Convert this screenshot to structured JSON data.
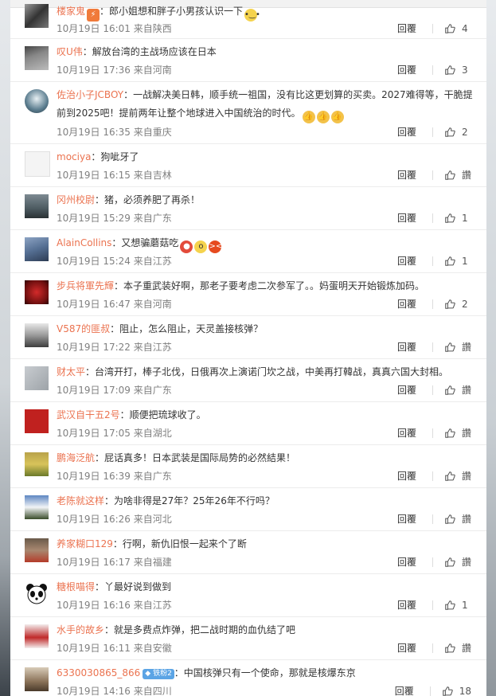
{
  "comments": [
    {
      "user": "楼家鬼",
      "text": "：郎小姐想和胖子小男孩认识一下",
      "time": "10月19日 16:01 来自陕西",
      "reply": "回覆",
      "likes": "4"
    },
    {
      "user": "叹U伟",
      "text": "：解放台湾的主战场应该在日本",
      "time": "10月19日 17:36 来自河南",
      "reply": "回覆",
      "likes": "3"
    },
    {
      "user": "佐治小子JCBOY",
      "text": "：一战解决美日韩，顺手统一祖国，没有比这更划算的买卖。2027难得等，干脆提前到2025吧！提前两年让整个地球进入中国统治的时代。",
      "time": "10月19日 16:35 来自重庆",
      "reply": "回覆",
      "likes": "2"
    },
    {
      "user": "mociya",
      "text": "：狗呲牙了",
      "time": "10月19日 16:15 来自吉林",
      "reply": "回覆",
      "likes": "讚"
    },
    {
      "user": "冈州校尉",
      "text": "：猪，必须养肥了再杀！",
      "time": "10月19日 15:29 来自广东",
      "reply": "回覆",
      "likes": "1"
    },
    {
      "user": "AlainCollins",
      "text": "：又想骗蘑菇吃",
      "time": "10月19日 15:24 来自江苏",
      "reply": "回覆",
      "likes": "1"
    },
    {
      "user": "步兵将軍先輝",
      "text": "：本子重武装好啊，那老子要考虑二次参军了。。妈蛋明天开始锻炼加码。",
      "time": "10月19日 16:47 来自河南",
      "reply": "回覆",
      "likes": "2"
    },
    {
      "user": "V587的匪叔",
      "text": "：阻止，怎么阻止，天灵盖接核弹？",
      "time": "10月19日 17:22 来自江苏",
      "reply": "回覆",
      "likes": "讚"
    },
    {
      "user": "财太平",
      "text": "：台湾开打，棒子北伐，日俄再次上演诺门坎之战，中美再打韓战，真真六国大封相。",
      "time": "10月19日 17:09 来自广东",
      "reply": "回覆",
      "likes": "讚"
    },
    {
      "user": "武汉自干五2号",
      "text": "：顺便把琉球收了。",
      "time": "10月19日 17:05 来自湖北",
      "reply": "回覆",
      "likes": "讚"
    },
    {
      "user": "鹏海泛航",
      "text": "：屁话真多！日本武装是国际局势的必然結果！",
      "time": "10月19日 16:39 来自广东",
      "reply": "回覆",
      "likes": "讚"
    },
    {
      "user": "老陈就这样",
      "text": "：为啥非得是27年？25年26年不行吗？",
      "time": "10月19日 16:26 来自河北",
      "reply": "回覆",
      "likes": "讚"
    },
    {
      "user": "养家糊口129",
      "text": "：行啊，新仇旧恨一起来个了断",
      "time": "10月19日 16:17 来自福建",
      "reply": "回覆",
      "likes": "讚"
    },
    {
      "user": "糖根喵得",
      "text": "：丫最好说到做到",
      "time": "10月19日 16:16 来自江苏",
      "reply": "回覆",
      "likes": "1"
    },
    {
      "user": "水手的故乡",
      "text": "：就是多费点炸弹，把二战时期的血仇结了吧",
      "time": "10月19日 16:11 来自安徽",
      "reply": "回覆",
      "likes": "讚"
    },
    {
      "user": "6330030865_866",
      "badge": "铁粉2",
      "text": "：中国核弹只有一个使命，那就是核爆东京",
      "time": "10月19日 14:16 来自四川",
      "reply": "回覆",
      "likes": "18"
    }
  ],
  "colors": {
    "username": "#eb7350",
    "text": "#333333",
    "meta": "#808080"
  }
}
